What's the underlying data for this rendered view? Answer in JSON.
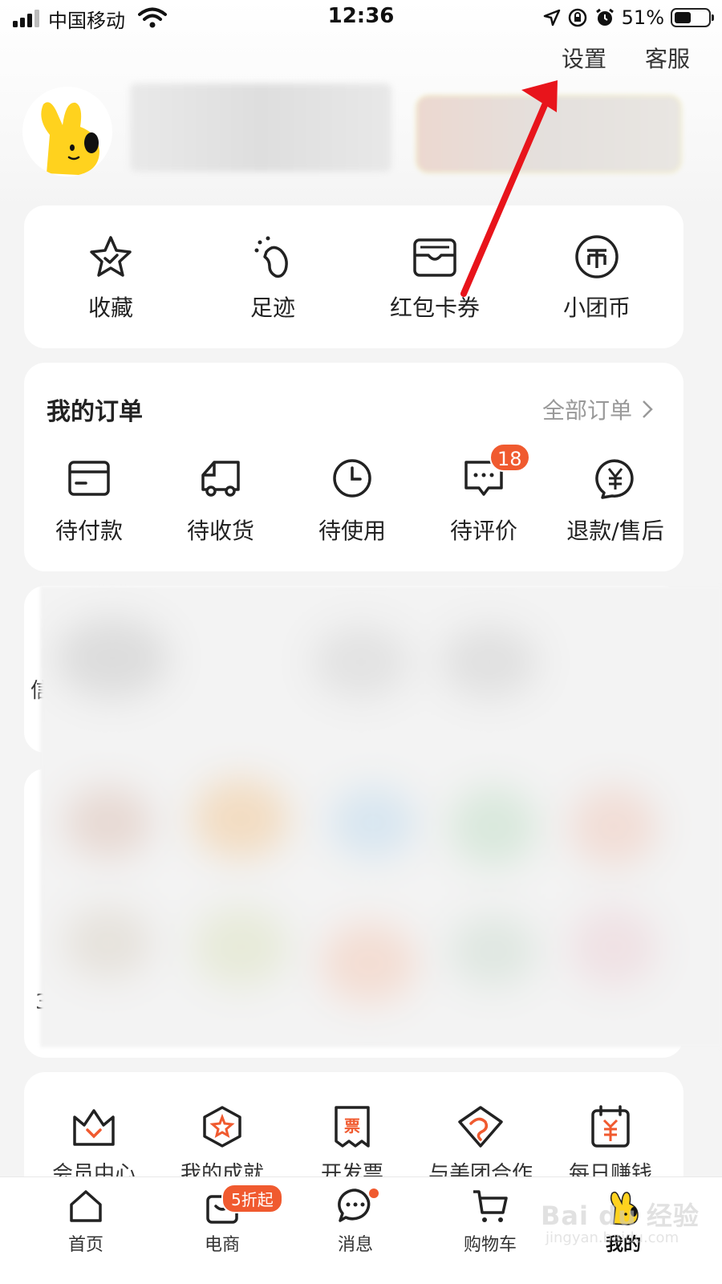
{
  "status_bar": {
    "carrier": "中国移动",
    "time": "12:36",
    "battery_text": "51%",
    "battery_level": 0.51
  },
  "header": {
    "settings_label": "设置",
    "service_label": "客服"
  },
  "shortcuts": [
    {
      "label": "收藏",
      "icon": "star-icon"
    },
    {
      "label": "足迹",
      "icon": "footprint-icon"
    },
    {
      "label": "红包卡券",
      "icon": "wallet-icon"
    },
    {
      "label": "小团币",
      "icon": "coin-icon"
    }
  ],
  "orders": {
    "title": "我的订单",
    "all_label": "全部订单",
    "items": [
      {
        "label": "待付款",
        "icon": "card-icon"
      },
      {
        "label": "待收货",
        "icon": "truck-icon"
      },
      {
        "label": "待使用",
        "icon": "clock-icon"
      },
      {
        "label": "待评价",
        "icon": "comment-icon",
        "badge": "18"
      },
      {
        "label": "退款/售后",
        "icon": "refund-icon"
      }
    ]
  },
  "blurred_section": {
    "partial_char_1": "信",
    "partial_char_2": "3"
  },
  "services": [
    {
      "label": "会员中心",
      "icon": "crown-icon"
    },
    {
      "label": "我的成就",
      "icon": "medal-icon"
    },
    {
      "label": "开发票",
      "icon": "invoice-icon",
      "icon_text": "票"
    },
    {
      "label": "与美团合作",
      "icon": "handshake-icon"
    },
    {
      "label": "每日赚钱",
      "icon": "calendar-yuan-icon"
    }
  ],
  "tabbar": {
    "items": [
      {
        "label": "首页",
        "icon": "home-icon"
      },
      {
        "label": "电商",
        "icon": "shop-bag-icon",
        "badge": "5折起"
      },
      {
        "label": "消息",
        "icon": "message-icon"
      },
      {
        "label": "购物车",
        "icon": "cart-icon"
      },
      {
        "label": "我的",
        "icon": "mascot-icon",
        "active": true
      }
    ]
  },
  "watermark": {
    "text": "Bai du 经验",
    "sub": "jingyan.baidu.com"
  },
  "colors": {
    "accent": "#f05a2f",
    "annotation_arrow": "#e8141b",
    "mascot_yellow": "#ffd21e"
  }
}
